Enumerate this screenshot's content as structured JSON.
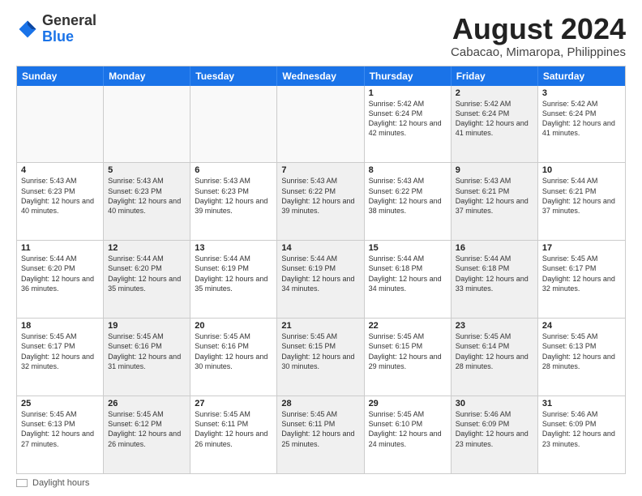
{
  "header": {
    "logo_general": "General",
    "logo_blue": "Blue",
    "main_title": "August 2024",
    "subtitle": "Cabacao, Mimaropa, Philippines"
  },
  "days_of_week": [
    "Sunday",
    "Monday",
    "Tuesday",
    "Wednesday",
    "Thursday",
    "Friday",
    "Saturday"
  ],
  "weeks": [
    [
      {
        "day": "",
        "text": "",
        "empty": true
      },
      {
        "day": "",
        "text": "",
        "empty": true
      },
      {
        "day": "",
        "text": "",
        "empty": true
      },
      {
        "day": "",
        "text": "",
        "empty": true
      },
      {
        "day": "1",
        "text": "Sunrise: 5:42 AM\nSunset: 6:24 PM\nDaylight: 12 hours\nand 42 minutes.",
        "empty": false
      },
      {
        "day": "2",
        "text": "Sunrise: 5:42 AM\nSunset: 6:24 PM\nDaylight: 12 hours\nand 41 minutes.",
        "empty": false,
        "shaded": true
      },
      {
        "day": "3",
        "text": "Sunrise: 5:42 AM\nSunset: 6:24 PM\nDaylight: 12 hours\nand 41 minutes.",
        "empty": false
      }
    ],
    [
      {
        "day": "4",
        "text": "Sunrise: 5:43 AM\nSunset: 6:23 PM\nDaylight: 12 hours\nand 40 minutes.",
        "empty": false
      },
      {
        "day": "5",
        "text": "Sunrise: 5:43 AM\nSunset: 6:23 PM\nDaylight: 12 hours\nand 40 minutes.",
        "empty": false,
        "shaded": true
      },
      {
        "day": "6",
        "text": "Sunrise: 5:43 AM\nSunset: 6:23 PM\nDaylight: 12 hours\nand 39 minutes.",
        "empty": false
      },
      {
        "day": "7",
        "text": "Sunrise: 5:43 AM\nSunset: 6:22 PM\nDaylight: 12 hours\nand 39 minutes.",
        "empty": false,
        "shaded": true
      },
      {
        "day": "8",
        "text": "Sunrise: 5:43 AM\nSunset: 6:22 PM\nDaylight: 12 hours\nand 38 minutes.",
        "empty": false
      },
      {
        "day": "9",
        "text": "Sunrise: 5:43 AM\nSunset: 6:21 PM\nDaylight: 12 hours\nand 37 minutes.",
        "empty": false,
        "shaded": true
      },
      {
        "day": "10",
        "text": "Sunrise: 5:44 AM\nSunset: 6:21 PM\nDaylight: 12 hours\nand 37 minutes.",
        "empty": false
      }
    ],
    [
      {
        "day": "11",
        "text": "Sunrise: 5:44 AM\nSunset: 6:20 PM\nDaylight: 12 hours\nand 36 minutes.",
        "empty": false
      },
      {
        "day": "12",
        "text": "Sunrise: 5:44 AM\nSunset: 6:20 PM\nDaylight: 12 hours\nand 35 minutes.",
        "empty": false,
        "shaded": true
      },
      {
        "day": "13",
        "text": "Sunrise: 5:44 AM\nSunset: 6:19 PM\nDaylight: 12 hours\nand 35 minutes.",
        "empty": false
      },
      {
        "day": "14",
        "text": "Sunrise: 5:44 AM\nSunset: 6:19 PM\nDaylight: 12 hours\nand 34 minutes.",
        "empty": false,
        "shaded": true
      },
      {
        "day": "15",
        "text": "Sunrise: 5:44 AM\nSunset: 6:18 PM\nDaylight: 12 hours\nand 34 minutes.",
        "empty": false
      },
      {
        "day": "16",
        "text": "Sunrise: 5:44 AM\nSunset: 6:18 PM\nDaylight: 12 hours\nand 33 minutes.",
        "empty": false,
        "shaded": true
      },
      {
        "day": "17",
        "text": "Sunrise: 5:45 AM\nSunset: 6:17 PM\nDaylight: 12 hours\nand 32 minutes.",
        "empty": false
      }
    ],
    [
      {
        "day": "18",
        "text": "Sunrise: 5:45 AM\nSunset: 6:17 PM\nDaylight: 12 hours\nand 32 minutes.",
        "empty": false
      },
      {
        "day": "19",
        "text": "Sunrise: 5:45 AM\nSunset: 6:16 PM\nDaylight: 12 hours\nand 31 minutes.",
        "empty": false,
        "shaded": true
      },
      {
        "day": "20",
        "text": "Sunrise: 5:45 AM\nSunset: 6:16 PM\nDaylight: 12 hours\nand 30 minutes.",
        "empty": false
      },
      {
        "day": "21",
        "text": "Sunrise: 5:45 AM\nSunset: 6:15 PM\nDaylight: 12 hours\nand 30 minutes.",
        "empty": false,
        "shaded": true
      },
      {
        "day": "22",
        "text": "Sunrise: 5:45 AM\nSunset: 6:15 PM\nDaylight: 12 hours\nand 29 minutes.",
        "empty": false
      },
      {
        "day": "23",
        "text": "Sunrise: 5:45 AM\nSunset: 6:14 PM\nDaylight: 12 hours\nand 28 minutes.",
        "empty": false,
        "shaded": true
      },
      {
        "day": "24",
        "text": "Sunrise: 5:45 AM\nSunset: 6:13 PM\nDaylight: 12 hours\nand 28 minutes.",
        "empty": false
      }
    ],
    [
      {
        "day": "25",
        "text": "Sunrise: 5:45 AM\nSunset: 6:13 PM\nDaylight: 12 hours\nand 27 minutes.",
        "empty": false
      },
      {
        "day": "26",
        "text": "Sunrise: 5:45 AM\nSunset: 6:12 PM\nDaylight: 12 hours\nand 26 minutes.",
        "empty": false,
        "shaded": true
      },
      {
        "day": "27",
        "text": "Sunrise: 5:45 AM\nSunset: 6:11 PM\nDaylight: 12 hours\nand 26 minutes.",
        "empty": false
      },
      {
        "day": "28",
        "text": "Sunrise: 5:45 AM\nSunset: 6:11 PM\nDaylight: 12 hours\nand 25 minutes.",
        "empty": false,
        "shaded": true
      },
      {
        "day": "29",
        "text": "Sunrise: 5:45 AM\nSunset: 6:10 PM\nDaylight: 12 hours\nand 24 minutes.",
        "empty": false
      },
      {
        "day": "30",
        "text": "Sunrise: 5:46 AM\nSunset: 6:09 PM\nDaylight: 12 hours\nand 23 minutes.",
        "empty": false,
        "shaded": true
      },
      {
        "day": "31",
        "text": "Sunrise: 5:46 AM\nSunset: 6:09 PM\nDaylight: 12 hours\nand 23 minutes.",
        "empty": false
      }
    ]
  ],
  "footer": {
    "legend_label": "Daylight hours"
  }
}
